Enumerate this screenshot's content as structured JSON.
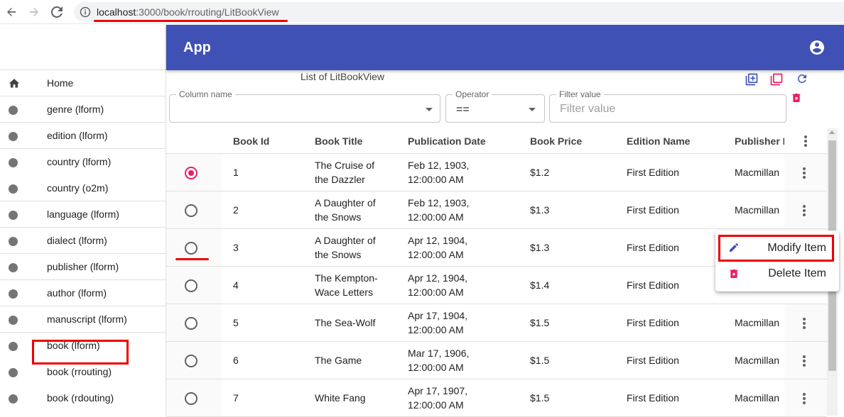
{
  "browser": {
    "url_host": "localhost",
    "url_path": ":3000/book/rrouting/LitBookView"
  },
  "app": {
    "title": "App"
  },
  "sidebar": {
    "items": [
      {
        "label": "Home",
        "icon": "home-icon"
      },
      {
        "label": "genre (lform)",
        "icon": "dot-icon"
      },
      {
        "label": "edition (lform)",
        "icon": "dot-icon"
      },
      {
        "label": "country (lform)",
        "icon": "dot-icon"
      },
      {
        "label": "country (o2m)",
        "icon": "dot-icon"
      },
      {
        "label": "language (lform)",
        "icon": "dot-icon"
      },
      {
        "label": "dialect (lform)",
        "icon": "dot-icon"
      },
      {
        "label": "publisher (lform)",
        "icon": "dot-icon"
      },
      {
        "label": "author (lform)",
        "icon": "dot-icon"
      },
      {
        "label": "manuscript (lform)",
        "icon": "dot-icon"
      },
      {
        "label": "book (lform)",
        "icon": "dot-icon"
      },
      {
        "label": "book (rrouting)",
        "icon": "dot-icon"
      },
      {
        "label": "book (rdouting)",
        "icon": "dot-icon"
      }
    ]
  },
  "main": {
    "list_title": "List of LitBookView",
    "filters": {
      "column_label": "Column name",
      "column_value": "",
      "operator_label": "Operator",
      "operator_value": "==",
      "value_label": "Filter value",
      "value_placeholder": "Filter value"
    },
    "toolbar_icons": [
      "add-copy-icon",
      "copy-icon",
      "refresh-icon",
      "delete-filter-icon"
    ],
    "colors": {
      "primary": "#3f51b5",
      "accent": "#e91e63",
      "highlight": "#e00000"
    }
  },
  "table": {
    "headers": [
      "Book Id",
      "Book Title",
      "Publication Date",
      "Book Price",
      "Edition Name",
      "Publisher N"
    ],
    "rows": [
      {
        "selected": true,
        "id": "1",
        "title1": "The Cruise of",
        "title2": "the Dazzler",
        "date1": "Feb 12, 1903,",
        "date2": "12:00:00 AM",
        "price": "$1.2",
        "edition": "First Edition",
        "publisher": "Macmillan"
      },
      {
        "selected": false,
        "id": "2",
        "title1": "A Daughter of",
        "title2": "the Snows",
        "date1": "Feb 12, 1903,",
        "date2": "12:00:00 AM",
        "price": "$1.3",
        "edition": "First Edition",
        "publisher": "Macmillan"
      },
      {
        "selected": false,
        "id": "3",
        "title1": "A Daughter of",
        "title2": "the Snows",
        "date1": "Apr 12, 1904,",
        "date2": "12:00:00 AM",
        "price": "$1.3",
        "edition": "First Edition",
        "publisher": ""
      },
      {
        "selected": false,
        "id": "4",
        "title1": "The Kempton-",
        "title2": "Wace Letters",
        "date1": "Apr 12, 1904,",
        "date2": "12:00:00 AM",
        "price": "$1.4",
        "edition": "First Edition",
        "publisher": ""
      },
      {
        "selected": false,
        "id": "5",
        "title1": "The Sea-Wolf",
        "title2": "",
        "date1": "Apr 17, 1904,",
        "date2": "12:00:00 AM",
        "price": "$1.5",
        "edition": "First Edition",
        "publisher": "Macmillan"
      },
      {
        "selected": false,
        "id": "6",
        "title1": "The Game",
        "title2": "",
        "date1": "Mar 17, 1906,",
        "date2": "12:00:00 AM",
        "price": "$1.5",
        "edition": "First Edition",
        "publisher": "Macmillan"
      },
      {
        "selected": false,
        "id": "7",
        "title1": "White Fang",
        "title2": "",
        "date1": "Apr 17, 1907,",
        "date2": "12:00:00 AM",
        "price": "$1.5",
        "edition": "First Edition",
        "publisher": "Macmillan"
      }
    ]
  },
  "context_menu": {
    "items": [
      {
        "label": "Modify Item",
        "icon": "pencil-icon"
      },
      {
        "label": "Delete Item",
        "icon": "trash-icon"
      }
    ]
  }
}
